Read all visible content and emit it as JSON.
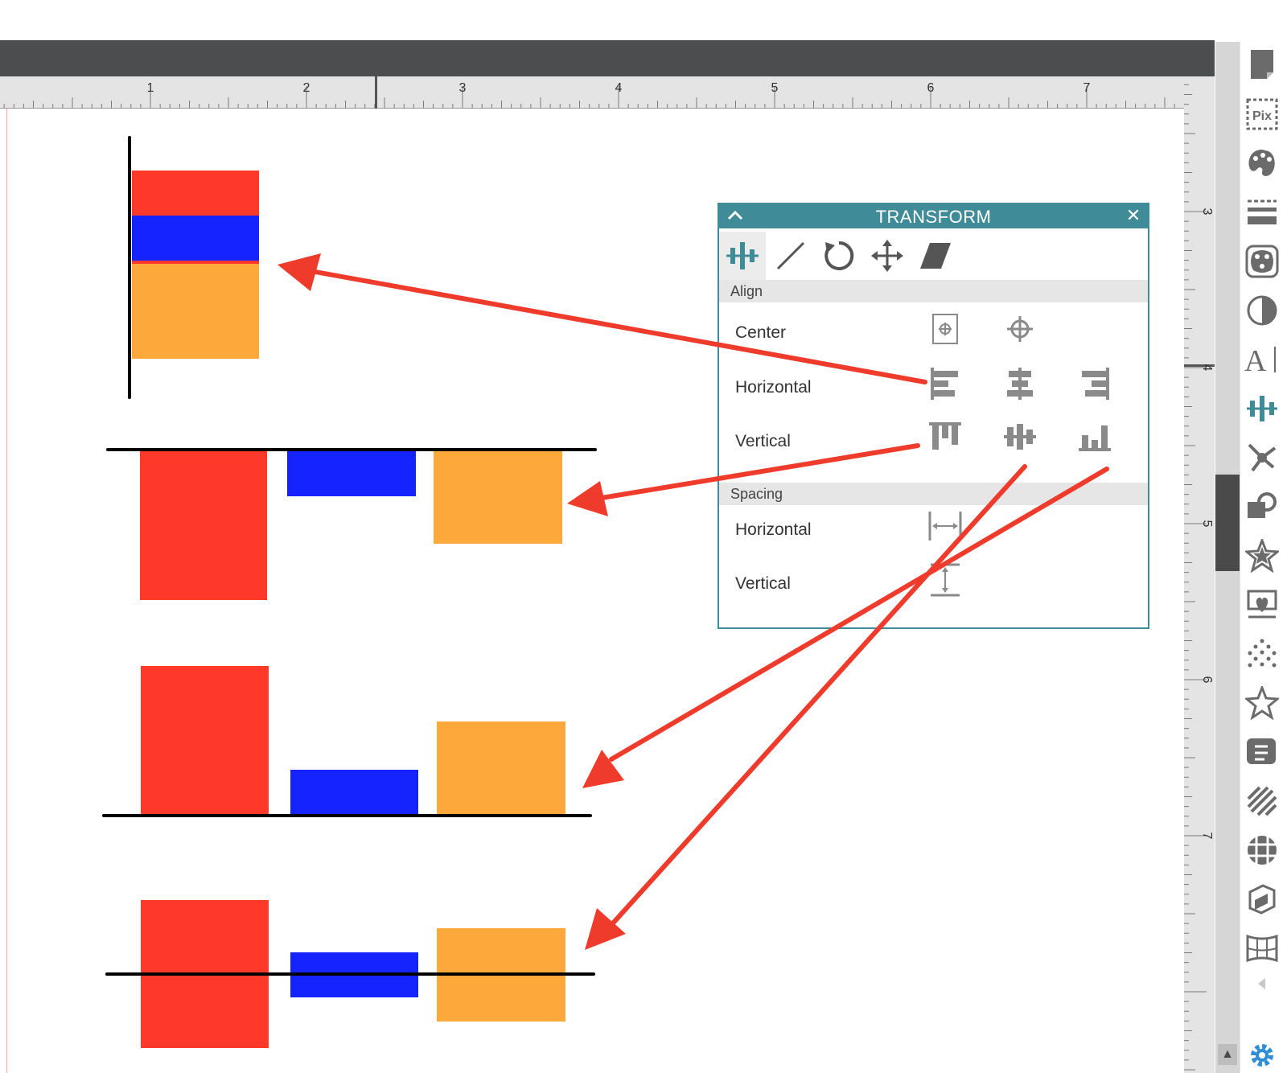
{
  "ruler": {
    "top_numbers": [
      "1",
      "2",
      "3",
      "4",
      "5",
      "6",
      "7"
    ],
    "side_numbers": [
      "3",
      "4",
      "5",
      "6",
      "7"
    ]
  },
  "transform_panel": {
    "title": "TRANSFORM",
    "close_glyph": "✕",
    "tabs": [
      "align-icon",
      "scale-icon",
      "rotate-icon",
      "move-icon",
      "shear-icon"
    ],
    "align_section": "Align",
    "spacing_section": "Spacing",
    "align_rows": {
      "center": "Center",
      "horizontal": "Horizontal",
      "vertical": "Vertical"
    },
    "spacing_rows": {
      "horizontal": "Horizontal",
      "vertical": "Vertical"
    }
  },
  "sidebar_tools": [
    "page-setup-icon",
    "pixscan-icon",
    "fill-color-icon",
    "line-style-icon",
    "image-effects-icon",
    "contrast-icon",
    "text-style-icon",
    "transform-icon",
    "replicate-icon",
    "modify-icon",
    "offset-star-icon",
    "trace-icon",
    "sketch-dots-icon",
    "star-outline-icon",
    "emboss-icon",
    "hatch-icon",
    "grid-icon",
    "3d-box-icon",
    "warp-icon"
  ],
  "colors": {
    "red": "#fe392a",
    "blue": "#1523fe",
    "orange": "#fca83b",
    "arrow": "#ef3b2c",
    "teal": "#3f8b97",
    "icon_gray": "#8a8a8a"
  }
}
